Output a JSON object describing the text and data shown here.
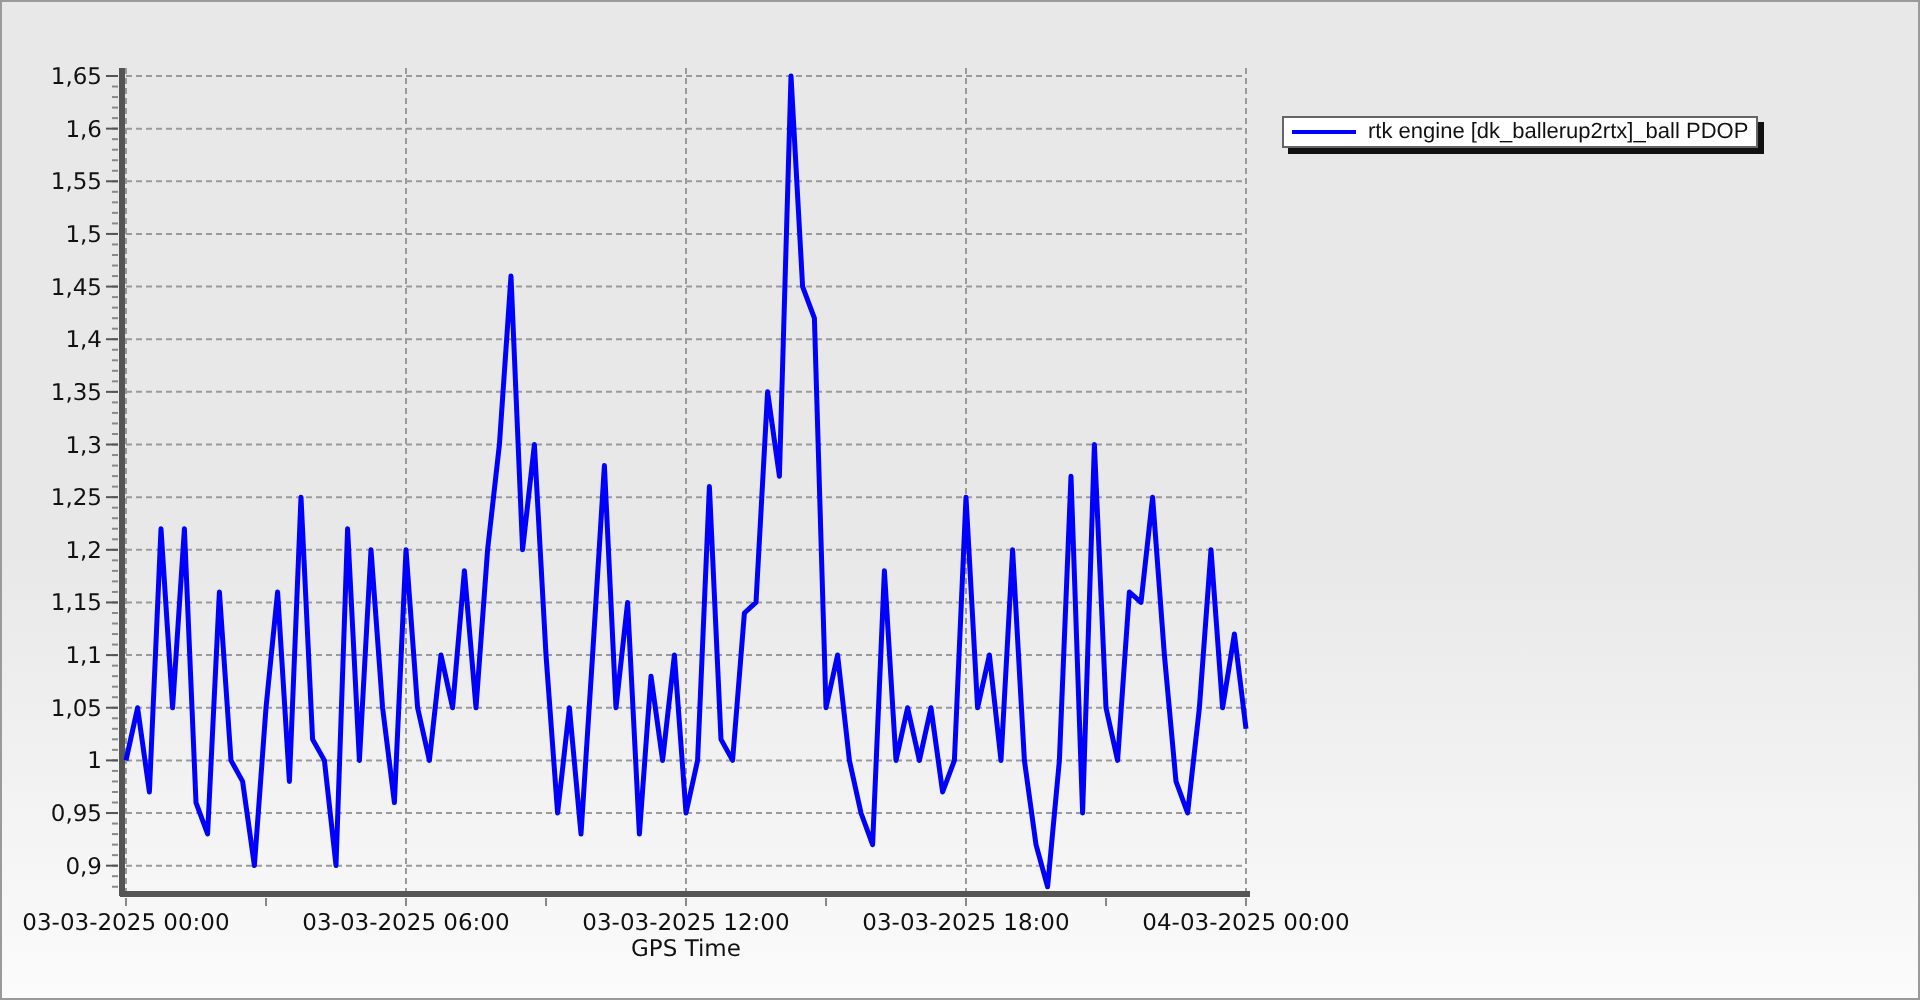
{
  "chart": {
    "chart_data": {
      "type": "line",
      "grid": true,
      "xlabel": "GPS Time",
      "categories": [
        "03-03-2025 00:00",
        null,
        null,
        null,
        null,
        null,
        null,
        null,
        null,
        null,
        null,
        null,
        null,
        null,
        null,
        null,
        null,
        null,
        null,
        null,
        null,
        null,
        null,
        null,
        "03-03-2025 06:00",
        null,
        null,
        null,
        null,
        null,
        null,
        null,
        null,
        null,
        null,
        null,
        null,
        null,
        null,
        null,
        null,
        null,
        null,
        null,
        null,
        null,
        null,
        null,
        "03-03-2025 12:00",
        null,
        null,
        null,
        null,
        null,
        null,
        null,
        null,
        null,
        null,
        null,
        null,
        null,
        null,
        null,
        null,
        null,
        null,
        null,
        null,
        null,
        null,
        null,
        "03-03-2025 18:00",
        null,
        null,
        null,
        null,
        null,
        null,
        null,
        null,
        null,
        null,
        null,
        null,
        null,
        null,
        null,
        null,
        null,
        null,
        null,
        null,
        null,
        null,
        null,
        "04-03-2025 00:00"
      ],
      "series": [
        {
          "name": "rtk engine [dk_ballerup2rtx]_ball PDOP",
          "color": "#0000ff",
          "values": [
            1.0,
            1.05,
            0.97,
            1.22,
            1.05,
            1.22,
            0.96,
            0.93,
            1.16,
            1.0,
            0.98,
            0.9,
            1.05,
            1.16,
            0.98,
            1.25,
            1.02,
            1.0,
            0.9,
            1.22,
            1.0,
            1.2,
            1.05,
            0.96,
            1.2,
            1.05,
            1.0,
            1.1,
            1.05,
            1.18,
            1.05,
            1.2,
            1.3,
            1.46,
            1.2,
            1.3,
            1.1,
            0.95,
            1.05,
            0.93,
            1.1,
            1.28,
            1.05,
            1.15,
            0.93,
            1.08,
            1.0,
            1.1,
            0.95,
            1.0,
            1.26,
            1.02,
            1.0,
            1.14,
            1.15,
            1.35,
            1.27,
            1.65,
            1.45,
            1.42,
            1.05,
            1.1,
            1.0,
            0.95,
            0.92,
            1.18,
            1.0,
            1.05,
            1.0,
            1.05,
            0.97,
            1.0,
            1.25,
            1.05,
            1.1,
            1.0,
            1.2,
            1.0,
            0.92,
            0.88,
            1.0,
            1.27,
            0.95,
            1.3,
            1.05,
            1.0,
            1.16,
            1.15,
            1.25,
            1.1,
            0.98,
            0.95,
            1.05,
            1.2,
            1.05,
            1.12,
            1.03
          ]
        }
      ],
      "ylim": [
        0.875,
        1.65
      ],
      "yticks": [
        {
          "value": 0.9,
          "label": "0,9"
        },
        {
          "value": 0.95,
          "label": "0,95"
        },
        {
          "value": 1,
          "label": "1"
        },
        {
          "value": 1.05,
          "label": "1,05"
        },
        {
          "value": 1.1,
          "label": "1,1"
        },
        {
          "value": 1.15,
          "label": "1,15"
        },
        {
          "value": 1.2,
          "label": "1,2"
        },
        {
          "value": 1.25,
          "label": "1,25"
        },
        {
          "value": 1.3,
          "label": "1,3"
        },
        {
          "value": 1.35,
          "label": "1,35"
        },
        {
          "value": 1.4,
          "label": "1,4"
        },
        {
          "value": 1.45,
          "label": "1,45"
        },
        {
          "value": 1.5,
          "label": "1,5"
        },
        {
          "value": 1.55,
          "label": "1,55"
        },
        {
          "value": 1.6,
          "label": "1,6"
        },
        {
          "value": 1.65,
          "label": "1,65"
        }
      ]
    }
  }
}
